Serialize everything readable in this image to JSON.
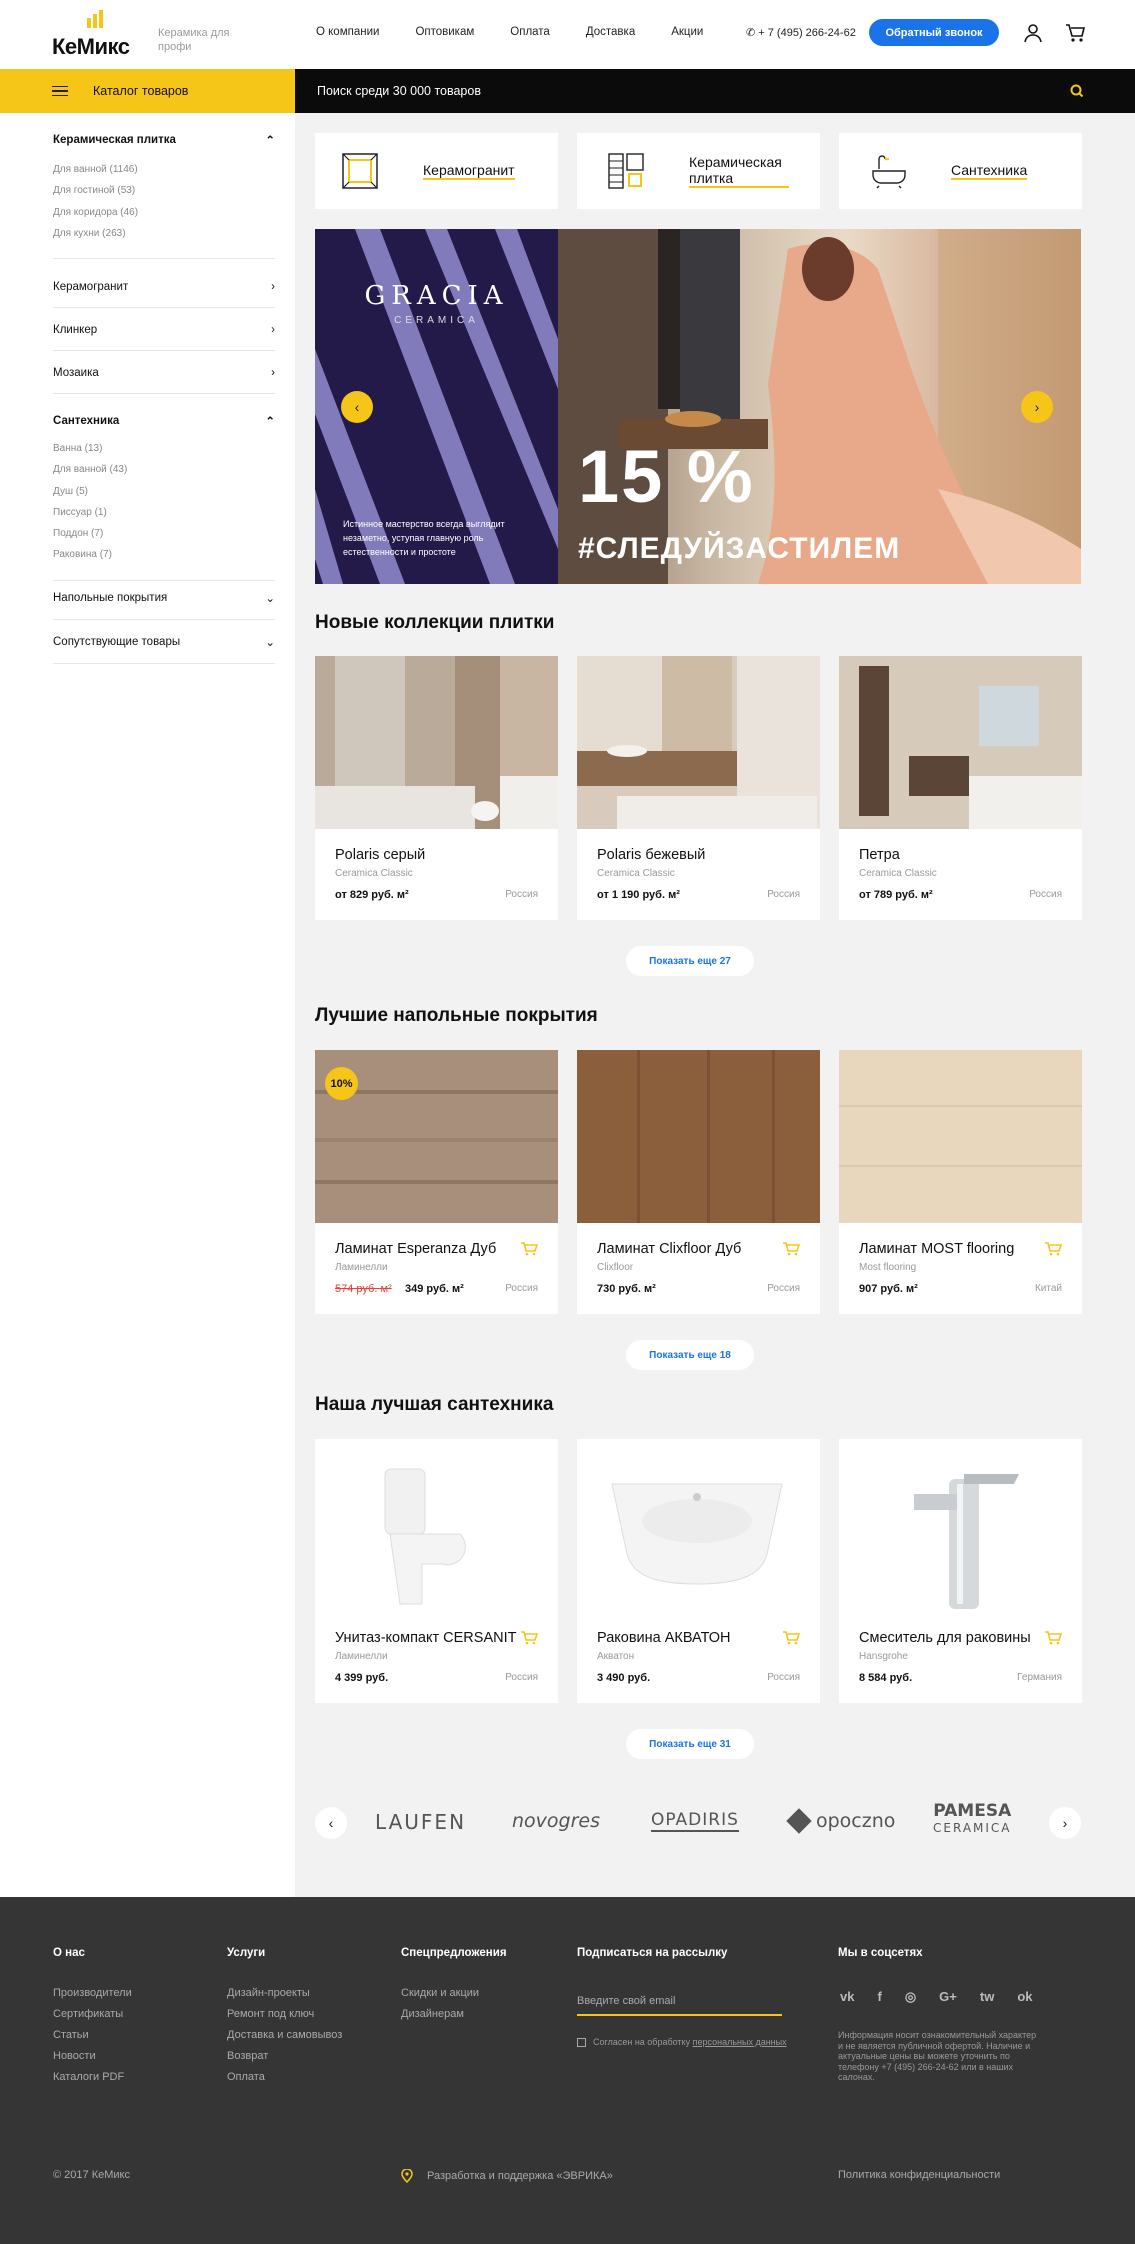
{
  "header": {
    "logo": "КеМикс",
    "tagline": "Керамика для профи",
    "nav": [
      "О компании",
      "Оптовикам",
      "Оплата",
      "Доставка",
      "Акции"
    ],
    "phone": "+ 7 (495) 266-24-62",
    "callback": "Обратный звонок",
    "icons": [
      "user-icon",
      "cart-icon"
    ]
  },
  "catalog_label": "Каталог товаров",
  "search": {
    "placeholder": "Поиск среди 30 000 товаров"
  },
  "sidebar": [
    {
      "label": "Керамическая плитка",
      "open": true,
      "items": [
        "Для ванной (1146)",
        "Для гостиной (53)",
        "Для коридора (46)",
        "Для кухни (263)"
      ]
    },
    {
      "label": "Керамогранит",
      "open": false,
      "items": []
    },
    {
      "label": "Клинкер",
      "open": false,
      "items": []
    },
    {
      "label": "Мозаика",
      "open": false,
      "items": []
    },
    {
      "label": "Сантехника",
      "open": true,
      "items": [
        "Ванна (13)",
        "Для ванной (43)",
        "Душ (5)",
        "Писсуар (1)",
        "Поддон (7)",
        "Раковина (7)"
      ]
    },
    {
      "label": "Напольные покрытия",
      "open": false,
      "items": []
    },
    {
      "label": "Сопутствующие товары",
      "open": false,
      "items": []
    }
  ],
  "tiles": [
    "Керамогранит",
    "Керамическая плитка",
    "Сантехника"
  ],
  "banner": {
    "brand": "GRACIA",
    "brand_sub": "CERAMICA",
    "text": "Истинное мастерство всегда выглядит незаметно, уступая главную роль естественности и простоте",
    "discount": "15 %",
    "hashtag": "#СЛЕДУЙЗАСТИЛЕМ"
  },
  "sections": {
    "tiles": {
      "title": "Новые коллекции плитки",
      "more": "Показать еще 27",
      "items": [
        {
          "name": "Polaris серый",
          "brand": "Ceramica Classic",
          "price": "от 829 руб. м²",
          "country": "Россия"
        },
        {
          "name": "Polaris бежевый",
          "brand": "Ceramica Classic",
          "price": "от 1 190 руб. м²",
          "country": "Россия"
        },
        {
          "name": "Петра",
          "brand": "Ceramica Classic",
          "price": "от 789 руб. м²",
          "country": "Россия"
        }
      ]
    },
    "floors": {
      "title": "Лучшие напольные покрытия",
      "more": "Показать еще 18",
      "items": [
        {
          "name": "Ламинат Esperanza Дуб",
          "brand": "Ламинелли",
          "old_price": "574 руб. м²",
          "price": "349 руб. м²",
          "country": "Россия",
          "badge": "10%"
        },
        {
          "name": "Ламинат Clixfloor Дуб",
          "brand": "Clixfloor",
          "price": "730 руб. м²",
          "country": "Россия"
        },
        {
          "name": "Ламинат MOST flooring",
          "brand": "Most flooring",
          "price": "907 руб. м²",
          "country": "Китай"
        }
      ]
    },
    "plumbing": {
      "title": "Наша лучшая сантехника",
      "more": "Показать еще 31",
      "items": [
        {
          "name": "Унитаз-компакт CERSANIT",
          "brand": "Ламинелли",
          "price": "4 399 руб.",
          "country": "Россия"
        },
        {
          "name": "Раковина АКВАТОН",
          "brand": "Акватон",
          "price": "3 490 руб.",
          "country": "Россия"
        },
        {
          "name": "Смеситель для раковины",
          "brand": "Hansgrohe",
          "price": "8 584 руб.",
          "country": "Германия"
        }
      ]
    }
  },
  "brands": [
    "LAUFEN",
    "novogres",
    "OPADIRIS",
    "opoczno",
    "PAMESA",
    "CERAMICA"
  ],
  "footer": {
    "about": {
      "title": "О нас",
      "links": [
        "Производители",
        "Сертификаты",
        "Статьи",
        "Новости",
        "Каталоги PDF"
      ]
    },
    "services": {
      "title": "Услуги",
      "links": [
        "Дизайн-проекты",
        "Ремонт под ключ",
        "Доставка и самовывоз",
        "Возврат",
        "Оплата"
      ]
    },
    "special": {
      "title": "Спецпредложения",
      "links": [
        "Скидки и акции",
        "Дизайнерам"
      ]
    },
    "subscribe": {
      "title": "Подписаться на рассылку",
      "placeholder": "Введите свой email",
      "consent": "Согласен на обработку",
      "consent_link": "персональных данных"
    },
    "social": {
      "title": "Мы в соцсетях",
      "icons": [
        "vk",
        "f",
        "◎",
        "G+",
        "tw",
        "ok"
      ]
    },
    "note": "Информация носит ознакомительный характер и не является публичной офертой. Наличие и актуальные цены вы можете уточнить по телефону +7 (495) 266-24-62 или в наших салонах.",
    "copyright": "© 2017 КеМикс",
    "dev": "Разработка и поддержка «ЭВРИКА»",
    "privacy": "Политика конфиденциальности"
  },
  "colors": {
    "accent": "#f5c518",
    "blue": "#1a73e8",
    "dark": "#353535"
  }
}
